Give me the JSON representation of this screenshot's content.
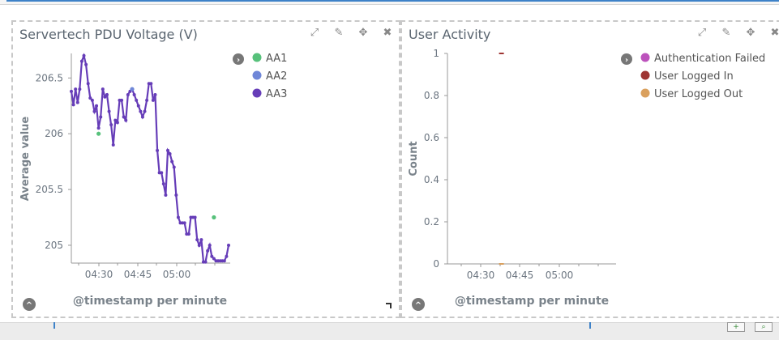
{
  "panel1": {
    "title": "Servertech PDU Voltage (V)",
    "ylabel": "Average value",
    "xlabel": "@timestamp per minute",
    "legend": [
      "AA1",
      "AA2",
      "AA3"
    ]
  },
  "panel2": {
    "title": "User Activity",
    "ylabel": "Count",
    "xlabel": "@timestamp per minute",
    "legend": [
      "Authentication Failed",
      "User Logged In",
      "User Logged Out"
    ]
  },
  "icons": {
    "expand": "expand-icon",
    "edit": "pencil-icon",
    "move": "move-icon",
    "close": "close-icon",
    "legend_toggle": "chevron-right-icon",
    "collapse": "chevron-up-icon",
    "resize": "resize-handle-icon"
  },
  "colors": {
    "AA1": "#57c17b",
    "AA2": "#6f87d8",
    "AA3": "#663db8",
    "Authentication Failed": "#bc52bc",
    "User Logged In": "#9e3533",
    "User Logged Out": "#daa05d"
  },
  "chart_data": [
    {
      "type": "line",
      "title": "Servertech PDU Voltage (V)",
      "xlabel": "@timestamp per minute",
      "ylabel": "Average value",
      "x_ticks": [
        "04:30",
        "04:45",
        "05:00"
      ],
      "y_ticks": [
        205,
        205.5,
        206,
        206.5
      ],
      "ylim": [
        204.84,
        206.72
      ],
      "xlim_minutes": [
        0,
        45
      ],
      "legend_position": "right",
      "grid": false,
      "series": [
        {
          "name": "AA3",
          "x": [
            0,
            0.6,
            1.2,
            1.8,
            2.4,
            3,
            3.6,
            4.2,
            4.8,
            5.4,
            6,
            6.6,
            7.2,
            7.8,
            8.4,
            9,
            9.6,
            10.2,
            10.8,
            11.4,
            12,
            12.6,
            13.2,
            13.8,
            14.4,
            15,
            15.6,
            16.2,
            16.8,
            17.4,
            18,
            18.6,
            19.2,
            19.8,
            20.4,
            21,
            21.6,
            22.2,
            22.8,
            23.4,
            24,
            24.6,
            25.2,
            25.8,
            26.4,
            27,
            27.6,
            28.2,
            28.8,
            29.4,
            30,
            30.6,
            31.2,
            31.8,
            32.4,
            33,
            33.6,
            34.2,
            34.8,
            35.4,
            36,
            36.6,
            37.2,
            37.8,
            38.4,
            39,
            39.6,
            40.2,
            40.8,
            41.4,
            42,
            42.6,
            43.2,
            43.8,
            44.4,
            45
          ],
          "y": [
            206.38,
            206.26,
            206.4,
            206.28,
            206.4,
            206.65,
            206.7,
            206.62,
            206.45,
            206.32,
            206.3,
            206.2,
            206.25,
            206.05,
            206.15,
            206.4,
            206.33,
            206.35,
            206.2,
            206.08,
            205.9,
            206.12,
            206.1,
            206.3,
            206.3,
            206.15,
            206.12,
            206.35,
            206.38,
            206.4,
            206.35,
            206.3,
            206.25,
            206.2,
            206.15,
            206.2,
            206.3,
            206.45,
            206.45,
            206.3,
            206.35,
            205.85,
            205.65,
            205.65,
            205.55,
            205.45,
            205.85,
            205.82,
            205.75,
            205.7,
            205.45,
            205.25,
            205.2,
            205.2,
            205.2,
            205.1,
            205.1,
            205.25,
            205.25,
            205.25,
            205.05,
            205.0,
            205.05,
            204.85,
            204.85,
            204.95,
            205.0,
            204.9,
            204.88,
            204.86,
            204.86,
            204.86,
            204.86,
            204.86,
            204.9,
            205.0
          ]
        },
        {
          "name": "AA1",
          "x": [
            7.8,
            40.8
          ],
          "y": [
            206.0,
            205.25
          ]
        },
        {
          "name": "AA2",
          "x": [
            17.4
          ],
          "y": [
            206.4
          ]
        }
      ]
    },
    {
      "type": "scatter",
      "title": "User Activity",
      "xlabel": "@timestamp per minute",
      "ylabel": "Count",
      "x_ticks": [
        "04:30",
        "04:45",
        "05:00"
      ],
      "y_ticks": [
        0,
        0.2,
        0.4,
        0.6,
        0.8,
        1
      ],
      "ylim": [
        0,
        1
      ],
      "legend_position": "right",
      "grid": false,
      "series": [
        {
          "name": "Authentication Failed",
          "x": [],
          "y": []
        },
        {
          "name": "User Logged In",
          "x": [
            "04:38"
          ],
          "y": [
            1
          ]
        },
        {
          "name": "User Logged Out",
          "x": [
            "04:38"
          ],
          "y": [
            0
          ]
        }
      ]
    }
  ]
}
